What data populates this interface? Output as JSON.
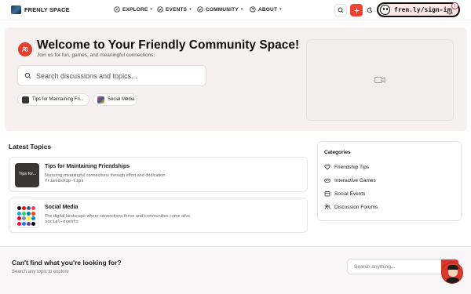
{
  "header": {
    "brand": "FRENLY SPACE",
    "nav": [
      {
        "label": "EXPLORE",
        "icon": "compass-icon"
      },
      {
        "label": "EVENTS",
        "icon": "check-circle-icon"
      },
      {
        "label": "COMMUNITY",
        "icon": "check-circle-icon"
      },
      {
        "label": "ABOUT",
        "icon": "help-circle-icon"
      }
    ],
    "signin_label": "fren.ly/sign-in",
    "notification_count": "1"
  },
  "hero": {
    "title": "Welcome to Your Friendly Community Space!",
    "subtitle": "Join us for fun, games, and meaningful connections.",
    "search_placeholder": "Search discussions and topics...",
    "chips": [
      {
        "label": "Tips for Maintaining Fri..."
      },
      {
        "label": "Social Media"
      }
    ]
  },
  "latest": {
    "title": "Latest Topics",
    "topics": [
      {
        "title": "Tips for Maintaining Friendships",
        "description": "Nurturing meaningful connections through effort and dedication",
        "slug": "friendship-tips",
        "thumb_text": "Tips for..."
      },
      {
        "title": "Social Media",
        "description": "The digital landscape where connections thrive and communities come alive",
        "slug": "social-events"
      }
    ]
  },
  "categories": {
    "title": "Categories",
    "items": [
      {
        "label": "Friendship Tips",
        "icon": "heart-icon"
      },
      {
        "label": "Interactive Games",
        "icon": "gamepad-icon"
      },
      {
        "label": "Social Events",
        "icon": "calendar-icon"
      },
      {
        "label": "Discussion Forums",
        "icon": "users-icon"
      }
    ]
  },
  "footer": {
    "title": "Can't find what you're looking for?",
    "subtitle": "Search any topic to explore",
    "search_placeholder": "Search anything..."
  },
  "colors": {
    "accent": "#e43d2f",
    "hero_bg": "#f6f1f0"
  }
}
